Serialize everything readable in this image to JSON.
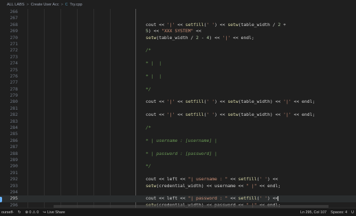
{
  "breadcrumb": {
    "items": [
      "ALL LABS",
      "Create User Acc",
      "Try.cpp"
    ],
    "separator": ">"
  },
  "editor": {
    "current_line": 295,
    "lines": [
      {
        "n": "266",
        "tokens": []
      },
      {
        "n": "267",
        "tokens": []
      },
      {
        "n": "268",
        "tokens": [
          [
            "op",
            "cout << "
          ],
          [
            "str",
            "'|'"
          ],
          [
            "op",
            " << "
          ],
          [
            "fn",
            "setfill"
          ],
          [
            "op",
            "("
          ],
          [
            "str",
            "' '"
          ],
          [
            "op",
            ") << "
          ],
          [
            "fn",
            "setw"
          ],
          [
            "op",
            "(table_width / "
          ],
          [
            "num",
            "2"
          ],
          [
            "op",
            " +"
          ]
        ]
      },
      {
        "n": "269",
        "tokens": [
          [
            "num",
            "5"
          ],
          [
            "op",
            ") << "
          ],
          [
            "str",
            "\"XXX SYSTEM\""
          ],
          [
            "op",
            " <<"
          ]
        ]
      },
      {
        "n": "270",
        "tokens": [
          [
            "fn",
            "setw"
          ],
          [
            "op",
            "(table_width / "
          ],
          [
            "num",
            "2"
          ],
          [
            "op",
            " - "
          ],
          [
            "num",
            "4"
          ],
          [
            "op",
            ") << "
          ],
          [
            "str",
            "'|'"
          ],
          [
            "op",
            " << endl;"
          ]
        ]
      },
      {
        "n": "271",
        "tokens": []
      },
      {
        "n": "272",
        "tokens": [
          [
            "cm",
            "/*"
          ]
        ]
      },
      {
        "n": "273",
        "tokens": []
      },
      {
        "n": "274",
        "tokens": [
          [
            "cm",
            "* |  |"
          ]
        ]
      },
      {
        "n": "275",
        "tokens": []
      },
      {
        "n": "276",
        "tokens": [
          [
            "cm",
            "* |  |"
          ]
        ]
      },
      {
        "n": "277",
        "tokens": []
      },
      {
        "n": "278",
        "tokens": [
          [
            "cm",
            "*/"
          ]
        ]
      },
      {
        "n": "279",
        "tokens": []
      },
      {
        "n": "280",
        "tokens": [
          [
            "op",
            "cout << "
          ],
          [
            "str",
            "'|'"
          ],
          [
            "op",
            " << "
          ],
          [
            "fn",
            "setfill"
          ],
          [
            "op",
            "("
          ],
          [
            "str",
            "' '"
          ],
          [
            "op",
            ") << "
          ],
          [
            "fn",
            "setw"
          ],
          [
            "op",
            "(table_width) << "
          ],
          [
            "str",
            "'|'"
          ],
          [
            "op",
            " << endl;"
          ]
        ]
      },
      {
        "n": "281",
        "tokens": []
      },
      {
        "n": "282",
        "tokens": [
          [
            "op",
            "cout << "
          ],
          [
            "str",
            "'|'"
          ],
          [
            "op",
            " << "
          ],
          [
            "fn",
            "setfill"
          ],
          [
            "op",
            "("
          ],
          [
            "str",
            "' '"
          ],
          [
            "op",
            ") << "
          ],
          [
            "fn",
            "setw"
          ],
          [
            "op",
            "(table_width) << "
          ],
          [
            "str",
            "'|'"
          ],
          [
            "op",
            " << endl;"
          ]
        ]
      },
      {
        "n": "283",
        "tokens": []
      },
      {
        "n": "284",
        "tokens": [
          [
            "cm",
            "/*"
          ]
        ]
      },
      {
        "n": "285",
        "tokens": []
      },
      {
        "n": "286",
        "tokens": [
          [
            "cm",
            "* | username : [username] |"
          ]
        ]
      },
      {
        "n": "287",
        "tokens": []
      },
      {
        "n": "288",
        "tokens": [
          [
            "cm",
            "* | password : [password] |"
          ]
        ]
      },
      {
        "n": "289",
        "tokens": []
      },
      {
        "n": "290",
        "tokens": [
          [
            "cm",
            "*/"
          ]
        ]
      },
      {
        "n": "291",
        "tokens": []
      },
      {
        "n": "292",
        "tokens": [
          [
            "op",
            "cout << left << "
          ],
          [
            "str",
            "\"| username : \""
          ],
          [
            "op",
            " << "
          ],
          [
            "fn",
            "setfill"
          ],
          [
            "op",
            "("
          ],
          [
            "str",
            "' '"
          ],
          [
            "op",
            ") <<"
          ]
        ]
      },
      {
        "n": "293",
        "tokens": [
          [
            "fn",
            "setw"
          ],
          [
            "op",
            "(credential_width) << username << "
          ],
          [
            "str",
            "\" |\""
          ],
          [
            "op",
            " << endl;"
          ]
        ]
      },
      {
        "n": "294",
        "tokens": []
      },
      {
        "n": "295",
        "tokens": [
          [
            "op",
            "cout << left << "
          ],
          [
            "str",
            "\"| password : \""
          ],
          [
            "op",
            " << "
          ],
          [
            "fn",
            "setfill"
          ],
          [
            "op",
            "("
          ],
          [
            "str",
            "' '"
          ],
          [
            "op",
            ") <<"
          ]
        ],
        "cursor": true
      },
      {
        "n": "296",
        "tokens": [
          [
            "fn",
            "setw"
          ],
          [
            "op",
            "(credential_width) << password << "
          ],
          [
            "str",
            "\" |\""
          ],
          [
            "op",
            " << endl;"
          ]
        ]
      }
    ]
  },
  "statusbar": {
    "left": [
      {
        "icon": "branch-icon",
        "label": "ourself-"
      },
      {
        "icon": "sync-icon",
        "label": "↻"
      },
      {
        "icon": "problems-icon",
        "label": "⊗ 0 ⚠ 0"
      },
      {
        "icon": "live-share-icon",
        "label": "Live Share"
      }
    ],
    "right": [
      {
        "label": "Ln 295, Col 107"
      },
      {
        "label": "Spaces: 4"
      },
      {
        "label": "U"
      }
    ]
  },
  "colors": {
    "background": "#1f1f1f",
    "keyword": "#9cdcfe",
    "function": "#dcdcaa",
    "string": "#ce9178",
    "number": "#b5cea8",
    "comment": "#6a9955"
  }
}
